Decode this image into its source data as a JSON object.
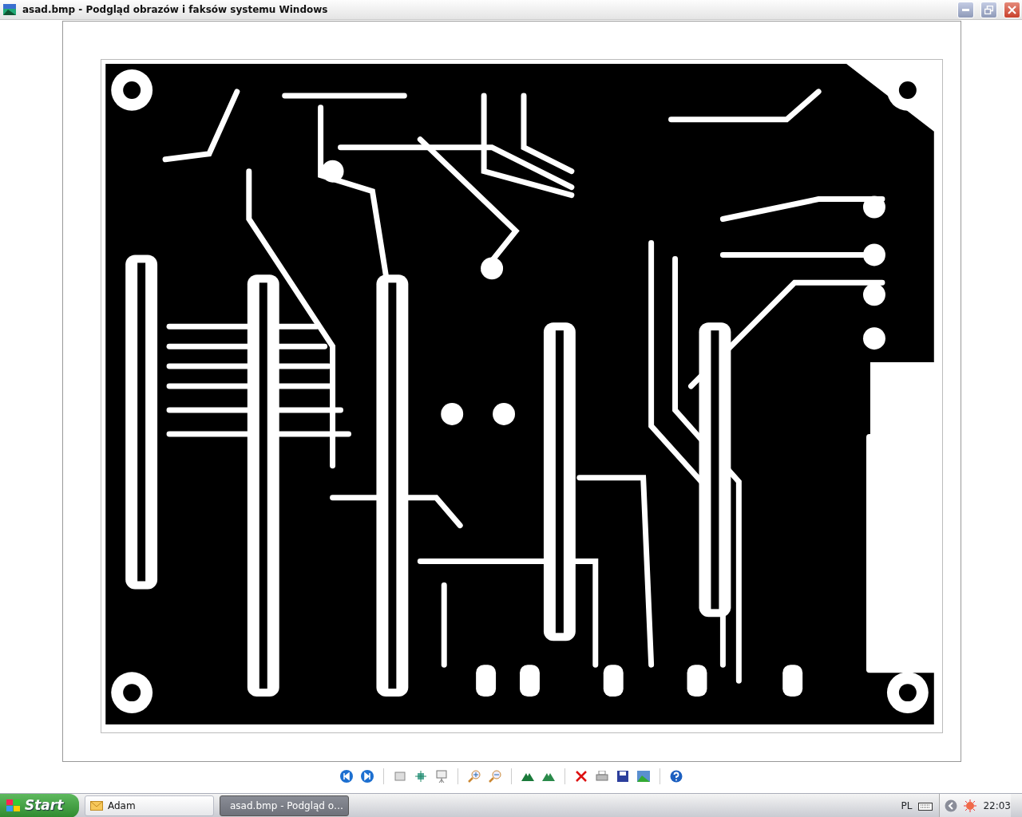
{
  "window": {
    "title": "asad.bmp - Podgląd obrazów i faksów systemu Windows"
  },
  "taskbar": {
    "start": "Start",
    "tasks": [
      {
        "label": "Adam",
        "selected": false,
        "kind": "mail"
      },
      {
        "label": "asad.bmp - Podgląd o…",
        "selected": true,
        "kind": "image"
      }
    ],
    "language": "PL",
    "clock": "22:03"
  }
}
